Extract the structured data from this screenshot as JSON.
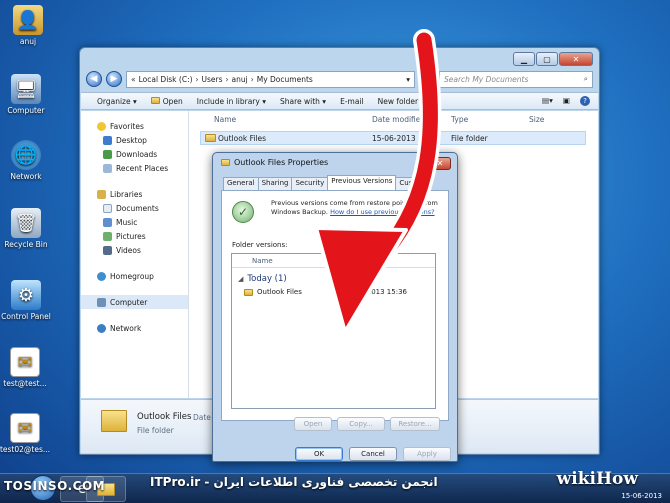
{
  "desktop": {
    "icons": [
      {
        "label": "anuj",
        "icon": "user-folder-icon"
      },
      {
        "label": "Computer",
        "icon": "computer-icon"
      },
      {
        "label": "Network",
        "icon": "network-icon"
      },
      {
        "label": "Recycle Bin",
        "icon": "recycle-bin-icon"
      },
      {
        "label": "Control Panel",
        "icon": "control-panel-icon"
      },
      {
        "label": "test@test...",
        "icon": "document-icon"
      },
      {
        "label": "test02@tes...",
        "icon": "document-icon"
      }
    ]
  },
  "explorer": {
    "address": {
      "prefix": "«",
      "segments": [
        "Local Disk (C:)",
        "Users",
        "anuj",
        "My Documents"
      ],
      "sep": "›"
    },
    "search_placeholder": "Search My Documents",
    "toolbar": [
      "Organize ▾",
      "Open",
      "Include in library ▾",
      "Share with ▾",
      "E-mail",
      "New folder"
    ],
    "nav": {
      "favorites": "Favorites",
      "favorites_items": [
        "Desktop",
        "Downloads",
        "Recent Places"
      ],
      "libraries": "Libraries",
      "libraries_items": [
        "Documents",
        "Music",
        "Pictures",
        "Videos"
      ],
      "homegroup": "Homegroup",
      "computer": "Computer",
      "network": "Network"
    },
    "columns": {
      "name": "Name",
      "date": "Date modifie",
      "type": "Type",
      "size": "Size"
    },
    "file": {
      "name": "Outlook Files",
      "date": "15-06-2013",
      "type": "File folder"
    },
    "details": {
      "name": "Outlook Files",
      "extra": "Date m",
      "type": "File folder"
    }
  },
  "dialog": {
    "title": "Outlook Files Properties",
    "close": "✕",
    "tabs": [
      "General",
      "Sharing",
      "Security",
      "Previous Versions",
      "Custo"
    ],
    "active_tab": 3,
    "description": "Previous versions come from restore points or from Windows Backup.",
    "link": "How do I use previous versions?",
    "folder_versions_label": "Folder versions:",
    "list_header": "Name",
    "group": "Today (1)",
    "version": {
      "name": "Outlook Files",
      "date": "15-06-2013 15:36"
    },
    "buttons": {
      "open": "Open",
      "copy": "Copy...",
      "restore": "Restore...",
      "ok": "OK",
      "cancel": "Cancel",
      "apply": "Apply"
    }
  },
  "taskbar": {
    "watermark_left": "TOSINSO.COM",
    "watermark_right": "ITPro.ir - انجمن تخصصی فناوری اطلاعات ایران",
    "logo": "wikiHow",
    "date": "15-06-2013"
  },
  "colors": {
    "arrow": "#e3141a",
    "arrow_outline": "#ffffff"
  }
}
